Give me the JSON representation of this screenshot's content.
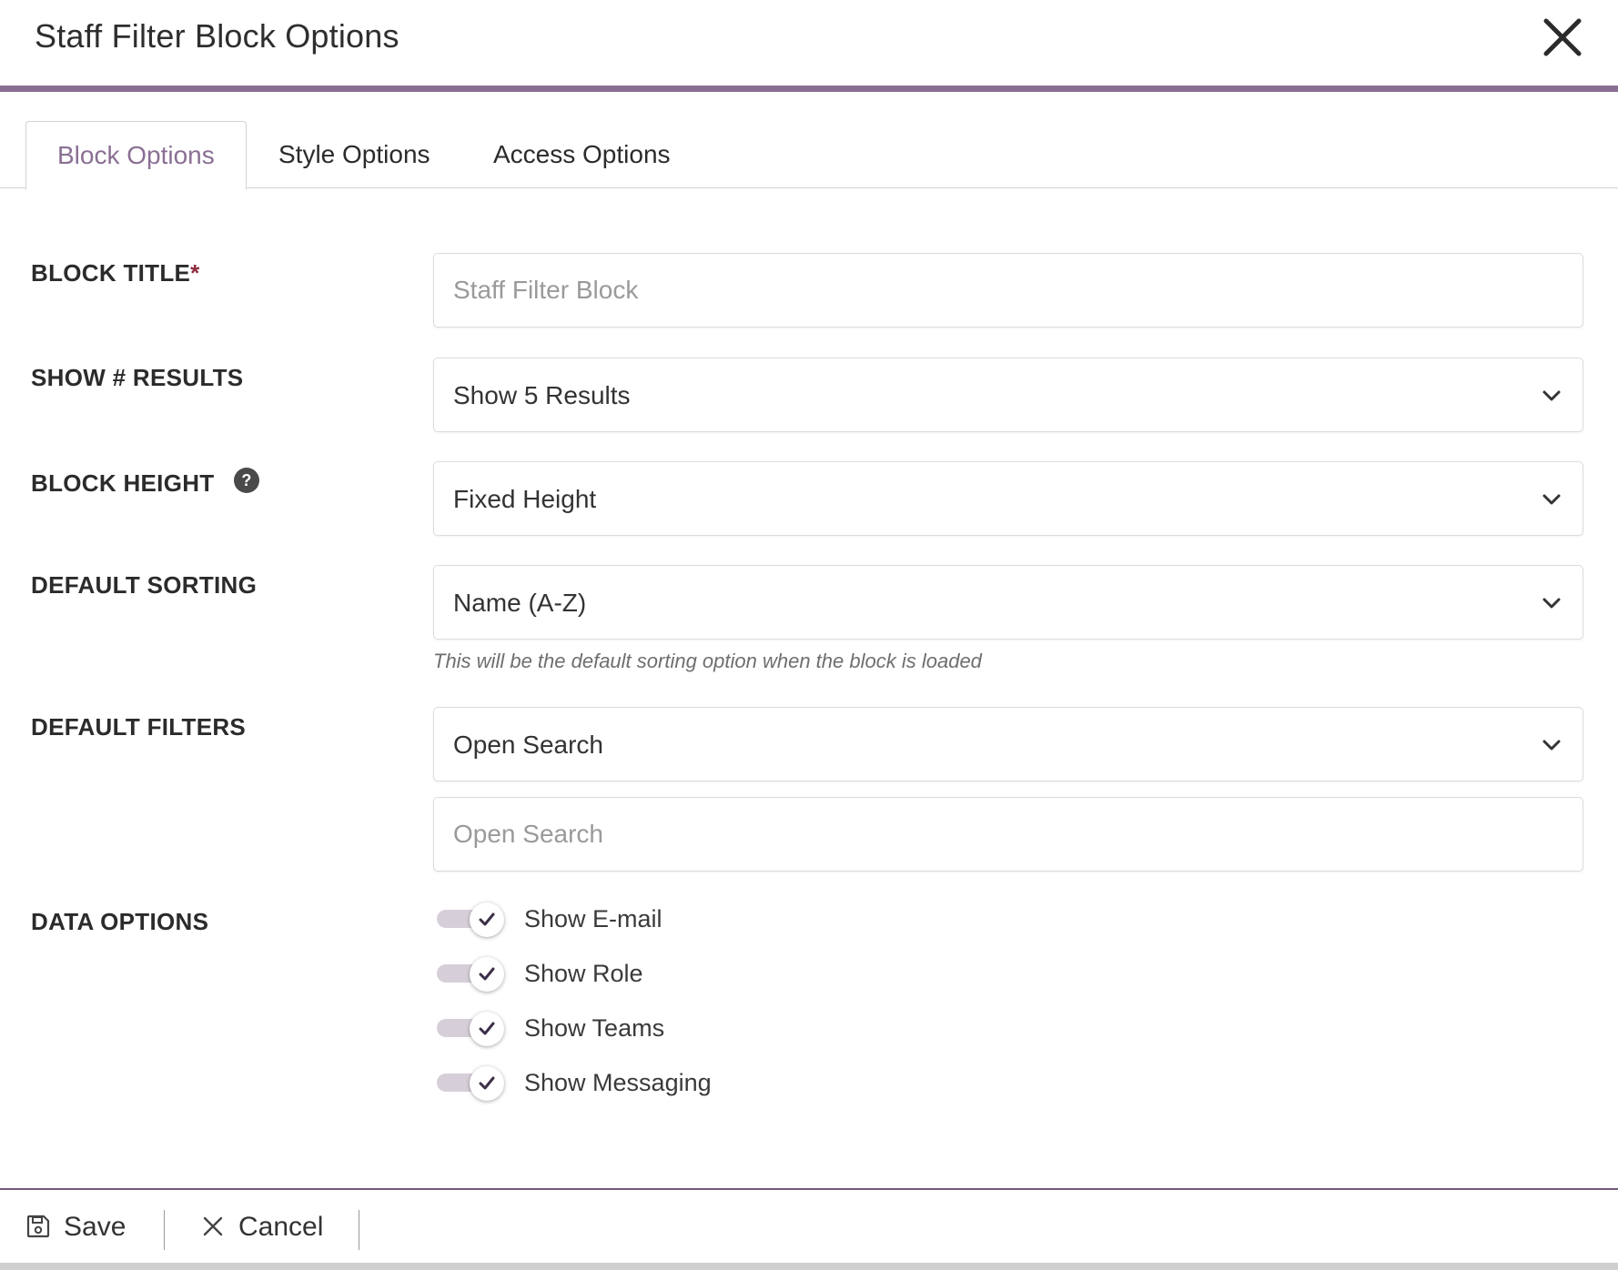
{
  "modal": {
    "title": "Staff Filter Block Options",
    "accent_color": "#8a6f93"
  },
  "tabs": [
    {
      "label": "Block Options",
      "active": true
    },
    {
      "label": "Style Options",
      "active": false
    },
    {
      "label": "Access Options",
      "active": false
    }
  ],
  "form": {
    "block_title": {
      "label": "BLOCK TITLE",
      "required_mark": "*",
      "placeholder": "Staff Filter Block"
    },
    "show_results": {
      "label": "SHOW # RESULTS",
      "value": "Show 5 Results"
    },
    "block_height": {
      "label": "BLOCK HEIGHT",
      "value": "Fixed Height",
      "help_icon": "question-circle-icon"
    },
    "default_sorting": {
      "label": "DEFAULT SORTING",
      "value": "Name (A-Z)",
      "hint": "This will be the default sorting option when the block is loaded"
    },
    "default_filters": {
      "label": "DEFAULT FILTERS",
      "value": "Open Search",
      "search_placeholder": "Open Search"
    },
    "data_options": {
      "label": "DATA OPTIONS",
      "toggles": [
        {
          "label": "Show E-mail",
          "checked": true
        },
        {
          "label": "Show Role",
          "checked": true
        },
        {
          "label": "Show Teams",
          "checked": true
        },
        {
          "label": "Show Messaging",
          "checked": true
        }
      ]
    }
  },
  "footer": {
    "save_label": "Save",
    "cancel_label": "Cancel"
  },
  "icons": {
    "close": "close-icon",
    "chevron": "chevron-down-icon",
    "save": "floppy-disk-icon",
    "cancel": "x-icon",
    "check": "check-icon"
  }
}
